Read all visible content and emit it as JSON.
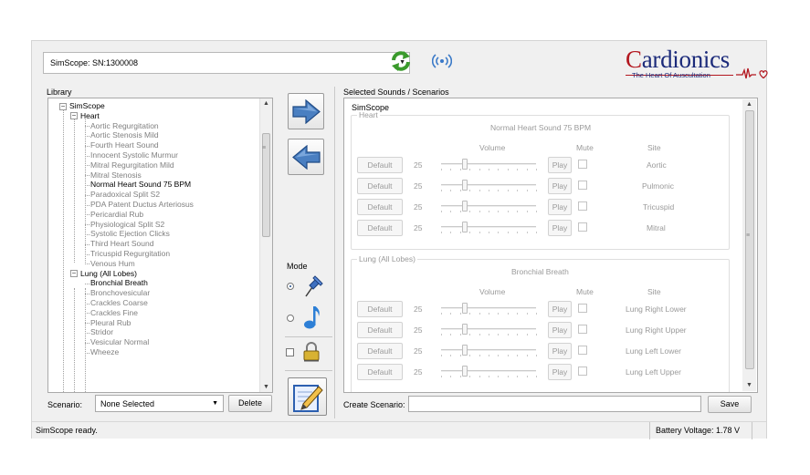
{
  "device_combo": {
    "value": "SimScope: SN:1300008"
  },
  "logo": {
    "brand": "Cardionics",
    "tagline": "The Heart Of Auscultation"
  },
  "library": {
    "label": "Library",
    "tree": [
      {
        "text": "SimScope",
        "level": 0,
        "toggle": "−",
        "style": "bold"
      },
      {
        "text": "Heart",
        "level": 1,
        "toggle": "−",
        "style": "bold"
      },
      {
        "text": "Aortic Regurgitation",
        "level": 2,
        "style": "dim"
      },
      {
        "text": "Aortic Stenosis Mild",
        "level": 2,
        "style": "dim"
      },
      {
        "text": "Fourth Heart Sound",
        "level": 2,
        "style": "dim"
      },
      {
        "text": "Innocent Systolic Murmur",
        "level": 2,
        "style": "dim"
      },
      {
        "text": "Mitral Regurgitation Mild",
        "level": 2,
        "style": "dim"
      },
      {
        "text": "Mitral Stenosis",
        "level": 2,
        "style": "dim"
      },
      {
        "text": "Normal Heart Sound 75 BPM",
        "level": 2,
        "style": "bold"
      },
      {
        "text": "Paradoxical Split S2",
        "level": 2,
        "style": "dim"
      },
      {
        "text": "PDA Patent Ductus Arteriosus",
        "level": 2,
        "style": "dim"
      },
      {
        "text": "Pericardial Rub",
        "level": 2,
        "style": "dim"
      },
      {
        "text": "Physiological Split S2",
        "level": 2,
        "style": "dim"
      },
      {
        "text": "Systolic Ejection Clicks",
        "level": 2,
        "style": "dim"
      },
      {
        "text": "Third Heart Sound",
        "level": 2,
        "style": "dim"
      },
      {
        "text": "Tricuspid Regurgitation",
        "level": 2,
        "style": "dim"
      },
      {
        "text": "Venous Hum",
        "level": 2,
        "style": "dim"
      },
      {
        "text": "Lung (All Lobes)",
        "level": 1,
        "toggle": "−",
        "style": "bold"
      },
      {
        "text": "Bronchial Breath",
        "level": 2,
        "style": "bold"
      },
      {
        "text": "Bronchovesicular",
        "level": 2,
        "style": "dim"
      },
      {
        "text": "Crackles Coarse",
        "level": 2,
        "style": "dim"
      },
      {
        "text": "Crackles Fine",
        "level": 2,
        "style": "dim"
      },
      {
        "text": "Pleural Rub",
        "level": 2,
        "style": "dim"
      },
      {
        "text": "Stridor",
        "level": 2,
        "style": "dim"
      },
      {
        "text": "Vesicular Normal",
        "level": 2,
        "style": "dim"
      },
      {
        "text": "Wheeze",
        "level": 2,
        "style": "dim"
      }
    ]
  },
  "scenario": {
    "label": "Scenario:",
    "selected": "None Selected",
    "delete_label": "Delete"
  },
  "mode": {
    "label": "Mode",
    "selected": "pin"
  },
  "selected": {
    "label": "Selected Sounds / Scenarios",
    "device": "SimScope",
    "groups": [
      {
        "title": "Heart",
        "sound": "Normal Heart Sound 75 BPM",
        "rows": [
          {
            "site": "Aortic",
            "volume": 25,
            "muted": false
          },
          {
            "site": "Pulmonic",
            "volume": 25,
            "muted": false
          },
          {
            "site": "Tricuspid",
            "volume": 25,
            "muted": false
          },
          {
            "site": "Mitral",
            "volume": 25,
            "muted": false
          }
        ]
      },
      {
        "title": "Lung (All Lobes)",
        "sound": "Bronchial Breath",
        "rows": [
          {
            "site": "Lung Right Lower",
            "volume": 25,
            "muted": false
          },
          {
            "site": "Lung Right Upper",
            "volume": 25,
            "muted": false
          },
          {
            "site": "Lung Left Lower",
            "volume": 25,
            "muted": false
          },
          {
            "site": "Lung Left Upper",
            "volume": 25,
            "muted": false
          }
        ]
      }
    ],
    "headers": {
      "volume": "Volume",
      "mute": "Mute",
      "site": "Site"
    },
    "default_label": "Default",
    "play_label": "Play"
  },
  "create": {
    "label": "Create Scenario:",
    "value": "",
    "save_label": "Save"
  },
  "status": {
    "message": "SimScope ready.",
    "battery": "Battery Voltage: 1.78 V"
  }
}
